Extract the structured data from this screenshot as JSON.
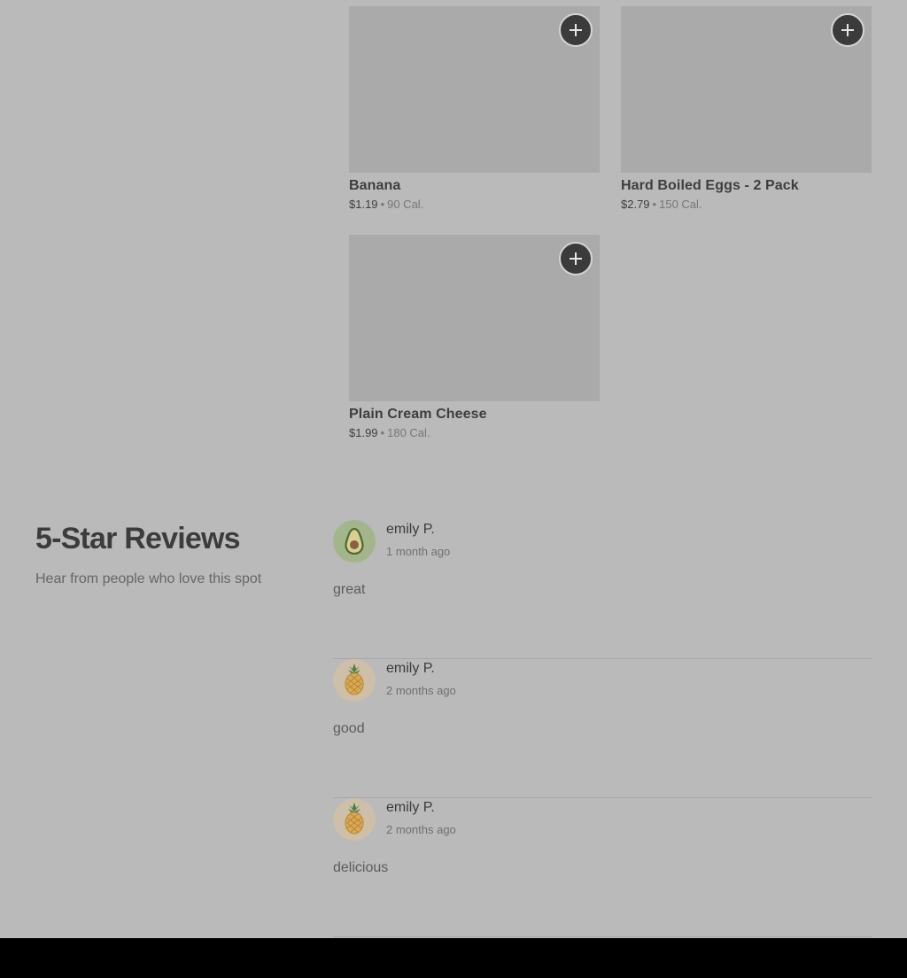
{
  "products": [
    {
      "name": "Banana",
      "price": "$1.19",
      "separator": "•",
      "calories": "90 Cal.",
      "add_icon": "plus-icon"
    },
    {
      "name": "Hard Boiled Eggs - 2 Pack",
      "price": "$2.79",
      "separator": "•",
      "calories": "150 Cal.",
      "add_icon": "plus-icon"
    },
    {
      "name": "Plain Cream Cheese",
      "price": "$1.99",
      "separator": "•",
      "calories": "180 Cal.",
      "add_icon": "plus-icon"
    }
  ],
  "reviews_section": {
    "title": "5-Star Reviews",
    "subtitle": "Hear from people who love this spot"
  },
  "reviews": [
    {
      "author": "emily P.",
      "time": "1 month ago",
      "text": "great",
      "avatar_icon": "avocado-icon"
    },
    {
      "author": "emily P.",
      "time": "2 months ago",
      "text": "good",
      "avatar_icon": "pineapple-icon"
    },
    {
      "author": "emily P.",
      "time": "2 months ago",
      "text": "delicious",
      "avatar_icon": "pineapple-icon"
    }
  ],
  "colors": {
    "page_background": "#bababa",
    "image_placeholder": "#aaaaaa",
    "add_button": "#3b3b3b",
    "avocado_avatar_bg": "#a3b58a",
    "pineapple_avatar_bg": "#cdbfa8"
  }
}
